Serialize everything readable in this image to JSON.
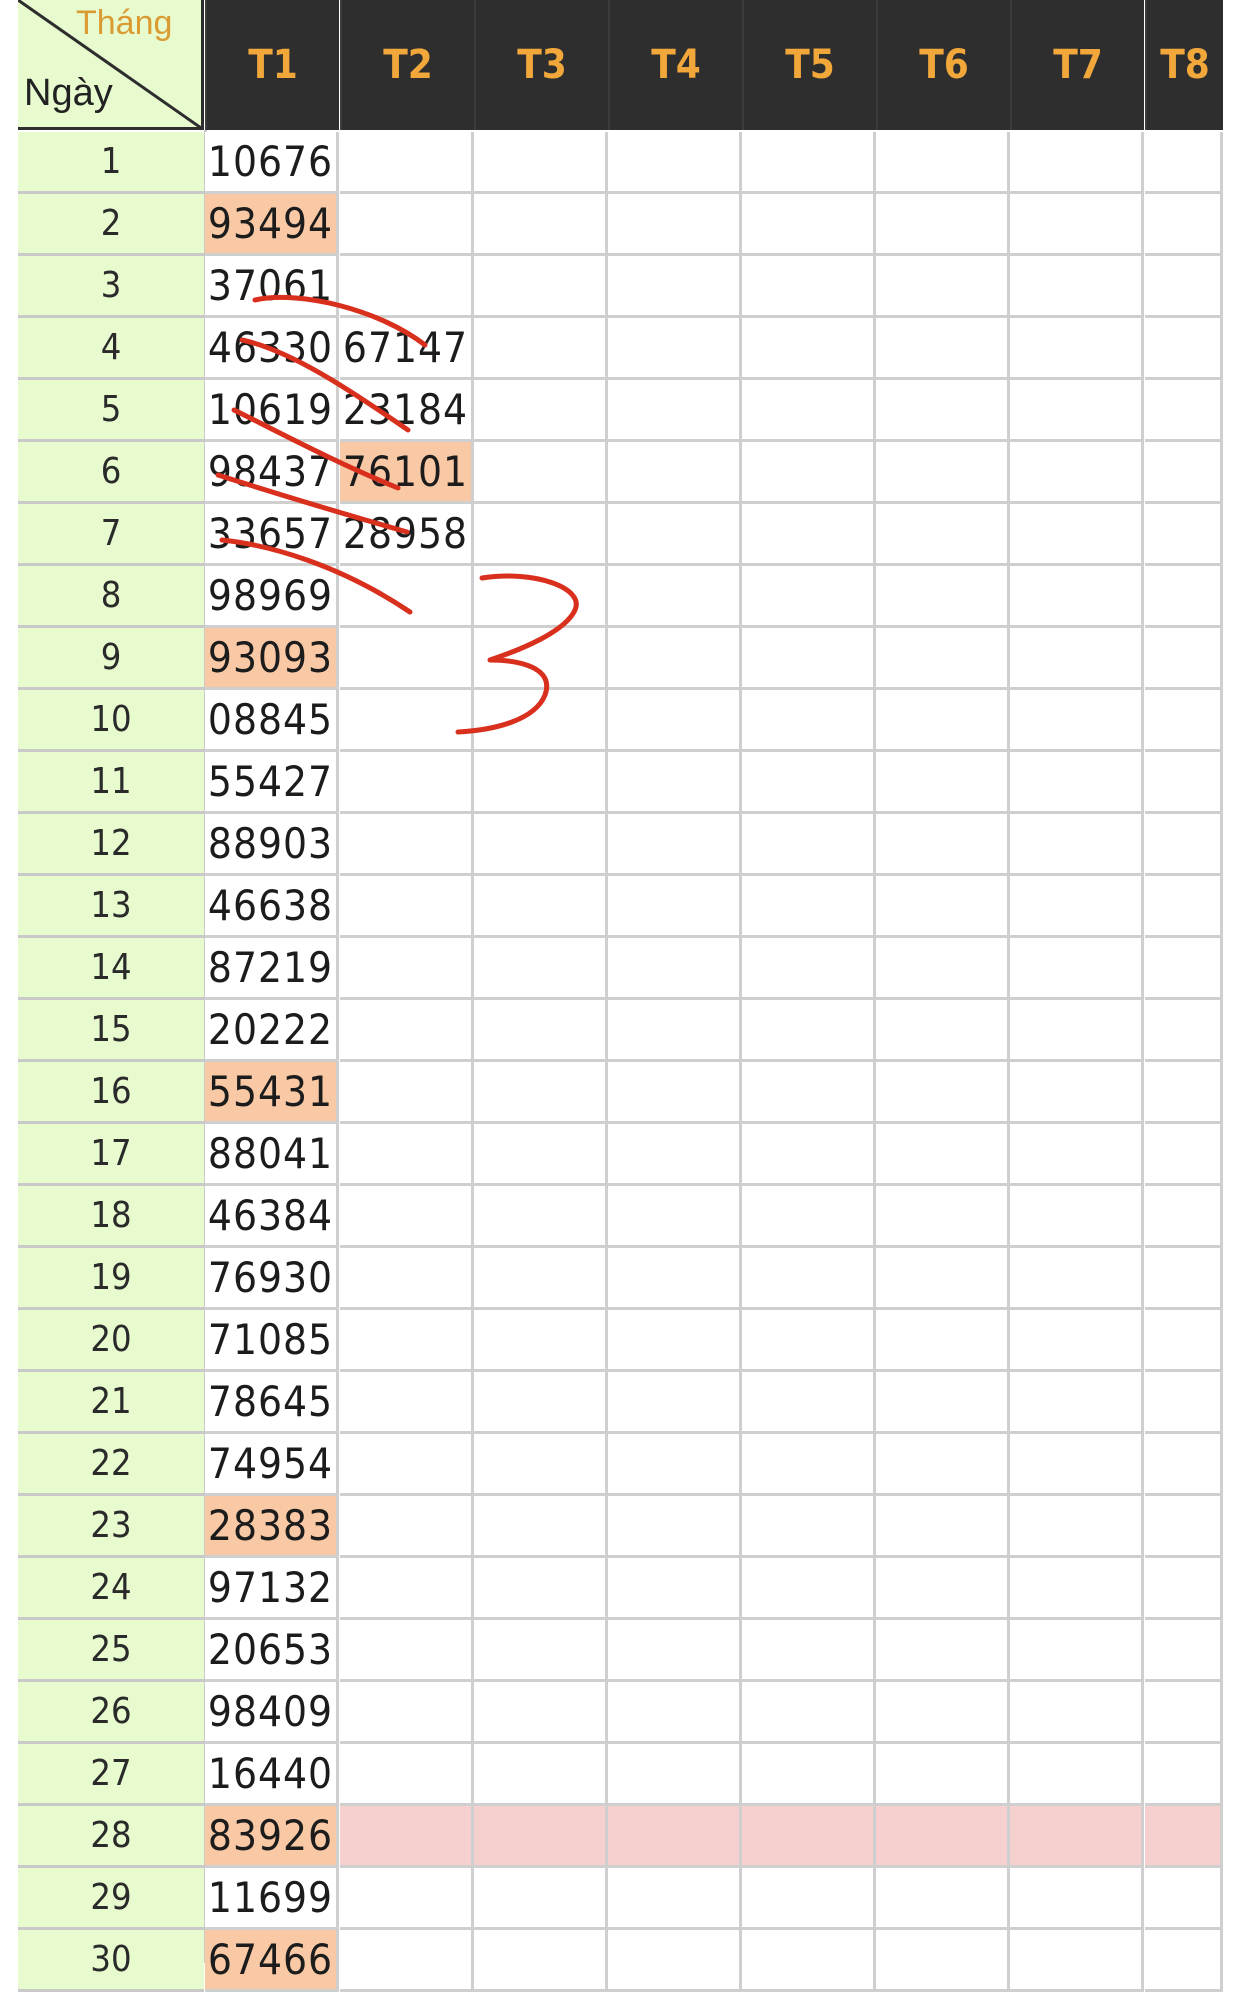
{
  "corner": {
    "month_label": "Tháng",
    "day_label": "Ngày"
  },
  "months": [
    "T1",
    "T2",
    "T3",
    "T4",
    "T5",
    "T6",
    "T7",
    "T8"
  ],
  "rows": [
    {
      "day": "1",
      "values": [
        "10676",
        "",
        "",
        "",
        "",
        "",
        "",
        ""
      ]
    },
    {
      "day": "2",
      "values": [
        "93494",
        "",
        "",
        "",
        "",
        "",
        "",
        ""
      ],
      "highlight": [
        0
      ]
    },
    {
      "day": "3",
      "values": [
        "37061",
        "",
        "",
        "",
        "",
        "",
        "",
        ""
      ]
    },
    {
      "day": "4",
      "values": [
        "46330",
        "67147",
        "",
        "",
        "",
        "",
        "",
        ""
      ]
    },
    {
      "day": "5",
      "values": [
        "10619",
        "23184",
        "",
        "",
        "",
        "",
        "",
        ""
      ]
    },
    {
      "day": "6",
      "values": [
        "98437",
        "76101",
        "",
        "",
        "",
        "",
        "",
        ""
      ],
      "highlight": [
        1
      ]
    },
    {
      "day": "7",
      "values": [
        "33657",
        "28958",
        "",
        "",
        "",
        "",
        "",
        ""
      ]
    },
    {
      "day": "8",
      "values": [
        "98969",
        "",
        "",
        "",
        "",
        "",
        "",
        ""
      ]
    },
    {
      "day": "9",
      "values": [
        "93093",
        "",
        "",
        "",
        "",
        "",
        "",
        ""
      ],
      "highlight": [
        0
      ]
    },
    {
      "day": "10",
      "values": [
        "08845",
        "",
        "",
        "",
        "",
        "",
        "",
        ""
      ]
    },
    {
      "day": "11",
      "values": [
        "55427",
        "",
        "",
        "",
        "",
        "",
        "",
        ""
      ]
    },
    {
      "day": "12",
      "values": [
        "88903",
        "",
        "",
        "",
        "",
        "",
        "",
        ""
      ]
    },
    {
      "day": "13",
      "values": [
        "46638",
        "",
        "",
        "",
        "",
        "",
        "",
        ""
      ]
    },
    {
      "day": "14",
      "values": [
        "87219",
        "",
        "",
        "",
        "",
        "",
        "",
        ""
      ]
    },
    {
      "day": "15",
      "values": [
        "20222",
        "",
        "",
        "",
        "",
        "",
        "",
        ""
      ]
    },
    {
      "day": "16",
      "values": [
        "55431",
        "",
        "",
        "",
        "",
        "",
        "",
        ""
      ],
      "highlight": [
        0
      ]
    },
    {
      "day": "17",
      "values": [
        "88041",
        "",
        "",
        "",
        "",
        "",
        "",
        ""
      ]
    },
    {
      "day": "18",
      "values": [
        "46384",
        "",
        "",
        "",
        "",
        "",
        "",
        ""
      ]
    },
    {
      "day": "19",
      "values": [
        "76930",
        "",
        "",
        "",
        "",
        "",
        "",
        ""
      ]
    },
    {
      "day": "20",
      "values": [
        "71085",
        "",
        "",
        "",
        "",
        "",
        "",
        ""
      ]
    },
    {
      "day": "21",
      "values": [
        "78645",
        "",
        "",
        "",
        "",
        "",
        "",
        ""
      ]
    },
    {
      "day": "22",
      "values": [
        "74954",
        "",
        "",
        "",
        "",
        "",
        "",
        ""
      ]
    },
    {
      "day": "23",
      "values": [
        "28383",
        "",
        "",
        "",
        "",
        "",
        "",
        ""
      ],
      "highlight": [
        0
      ]
    },
    {
      "day": "24",
      "values": [
        "97132",
        "",
        "",
        "",
        "",
        "",
        "",
        ""
      ]
    },
    {
      "day": "25",
      "values": [
        "20653",
        "",
        "",
        "",
        "",
        "",
        "",
        ""
      ]
    },
    {
      "day": "26",
      "values": [
        "98409",
        "",
        "",
        "",
        "",
        "",
        "",
        ""
      ]
    },
    {
      "day": "27",
      "values": [
        "16440",
        "",
        "",
        "",
        "",
        "",
        "",
        ""
      ]
    },
    {
      "day": "28",
      "values": [
        "83926",
        "",
        "",
        "",
        "",
        "",
        "",
        ""
      ],
      "highlight": [
        0
      ],
      "row_pink": true
    },
    {
      "day": "29",
      "values": [
        "11699",
        "",
        "",
        "",
        "",
        "",
        "",
        ""
      ]
    },
    {
      "day": "30",
      "values": [
        "67466",
        "",
        "",
        "",
        "",
        "",
        "",
        ""
      ],
      "highlight": [
        0
      ]
    }
  ],
  "annotation": {
    "handwritten_text": "3"
  },
  "colors": {
    "header_bg": "#2e2e2e",
    "header_text": "#f1a73a",
    "day_column_bg": "#e8fbcf",
    "highlight_cell": "#f9c9a6",
    "highlight_row": "#f6cfcf",
    "ink": "#d9301e"
  }
}
